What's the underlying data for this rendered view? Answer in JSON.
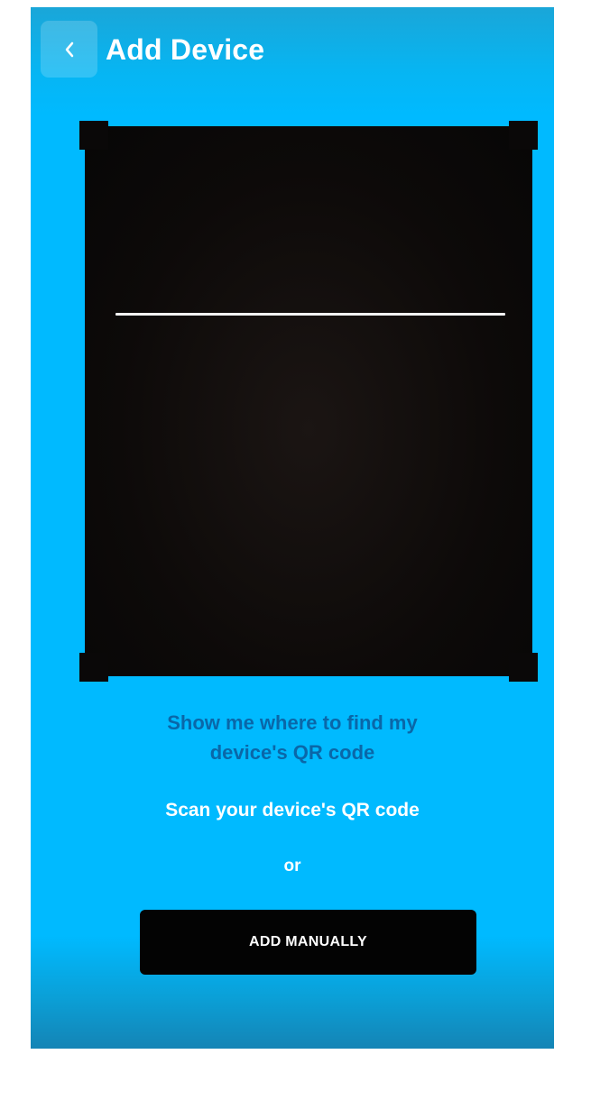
{
  "header": {
    "back_icon": "chevron-left-icon",
    "title": "Add Device"
  },
  "scanner": {
    "corner_color": "#0a0808",
    "scan_line_color": "#f4f4f4"
  },
  "help_link": {
    "line1": "Show me where to find my",
    "line2": "device's QR code"
  },
  "instructions": {
    "scan_text": "Scan your device's QR code",
    "or_text": "or"
  },
  "actions": {
    "add_manually_label": "ADD MANUALLY"
  },
  "colors": {
    "background": "#00baff",
    "link": "#0a67a8",
    "button": "#030303"
  }
}
